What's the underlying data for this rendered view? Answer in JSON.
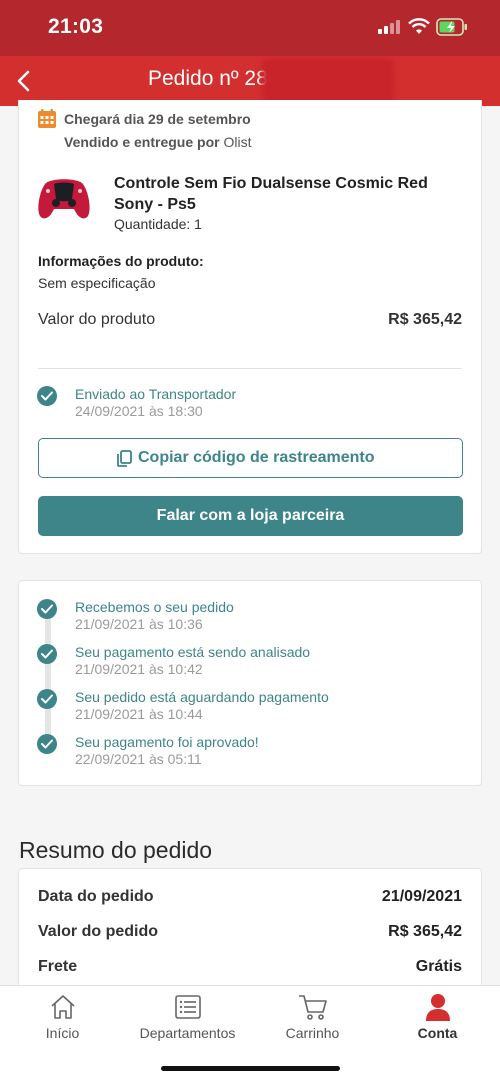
{
  "status_bar": {
    "time": "21:03"
  },
  "nav": {
    "title": "Pedido nº 28"
  },
  "order": {
    "delivery": "Chegará dia 29 de setembro",
    "sold_prefix": "Vendido e entregue por",
    "seller": "Olist",
    "product_name": "Controle Sem Fio Dualsense Cosmic Red Sony - Ps5",
    "quantity": "Quantidade: 1",
    "info_label": "Informações do produto:",
    "info_value": "Sem especificação",
    "value_label": "Valor do produto",
    "value": "R$ 365,42",
    "shipping_status": "Enviado ao Transportador",
    "shipping_date": "24/09/2021 às 18:30",
    "copy_button": "Copiar código de rastreamento",
    "talk_button": "Falar com a loja parceira"
  },
  "timeline": [
    {
      "label": "Recebemos o seu pedido",
      "date": "21/09/2021 às 10:36"
    },
    {
      "label": "Seu pagamento está sendo analisado",
      "date": "21/09/2021 às 10:42"
    },
    {
      "label": "Seu pedido está aguardando pagamento",
      "date": "21/09/2021 às 10:44"
    },
    {
      "label": "Seu pagamento foi aprovado!",
      "date": "22/09/2021 às 05:11"
    }
  ],
  "summary": {
    "title": "Resumo do pedido",
    "rows": [
      {
        "label": "Data do pedido",
        "value": "21/09/2021"
      },
      {
        "label": "Valor do pedido",
        "value": "R$ 365,42"
      },
      {
        "label": "Frete",
        "value": "Grátis"
      }
    ]
  },
  "tabs": [
    {
      "label": "Início",
      "icon": "home-icon"
    },
    {
      "label": "Departamentos",
      "icon": "list-icon"
    },
    {
      "label": "Carrinho",
      "icon": "cart-icon"
    },
    {
      "label": "Conta",
      "icon": "user-icon",
      "active": true
    }
  ],
  "colors": {
    "brand_red": "#d32f2f",
    "teal": "#3d8589",
    "calendar_orange": "#e98b2e"
  }
}
